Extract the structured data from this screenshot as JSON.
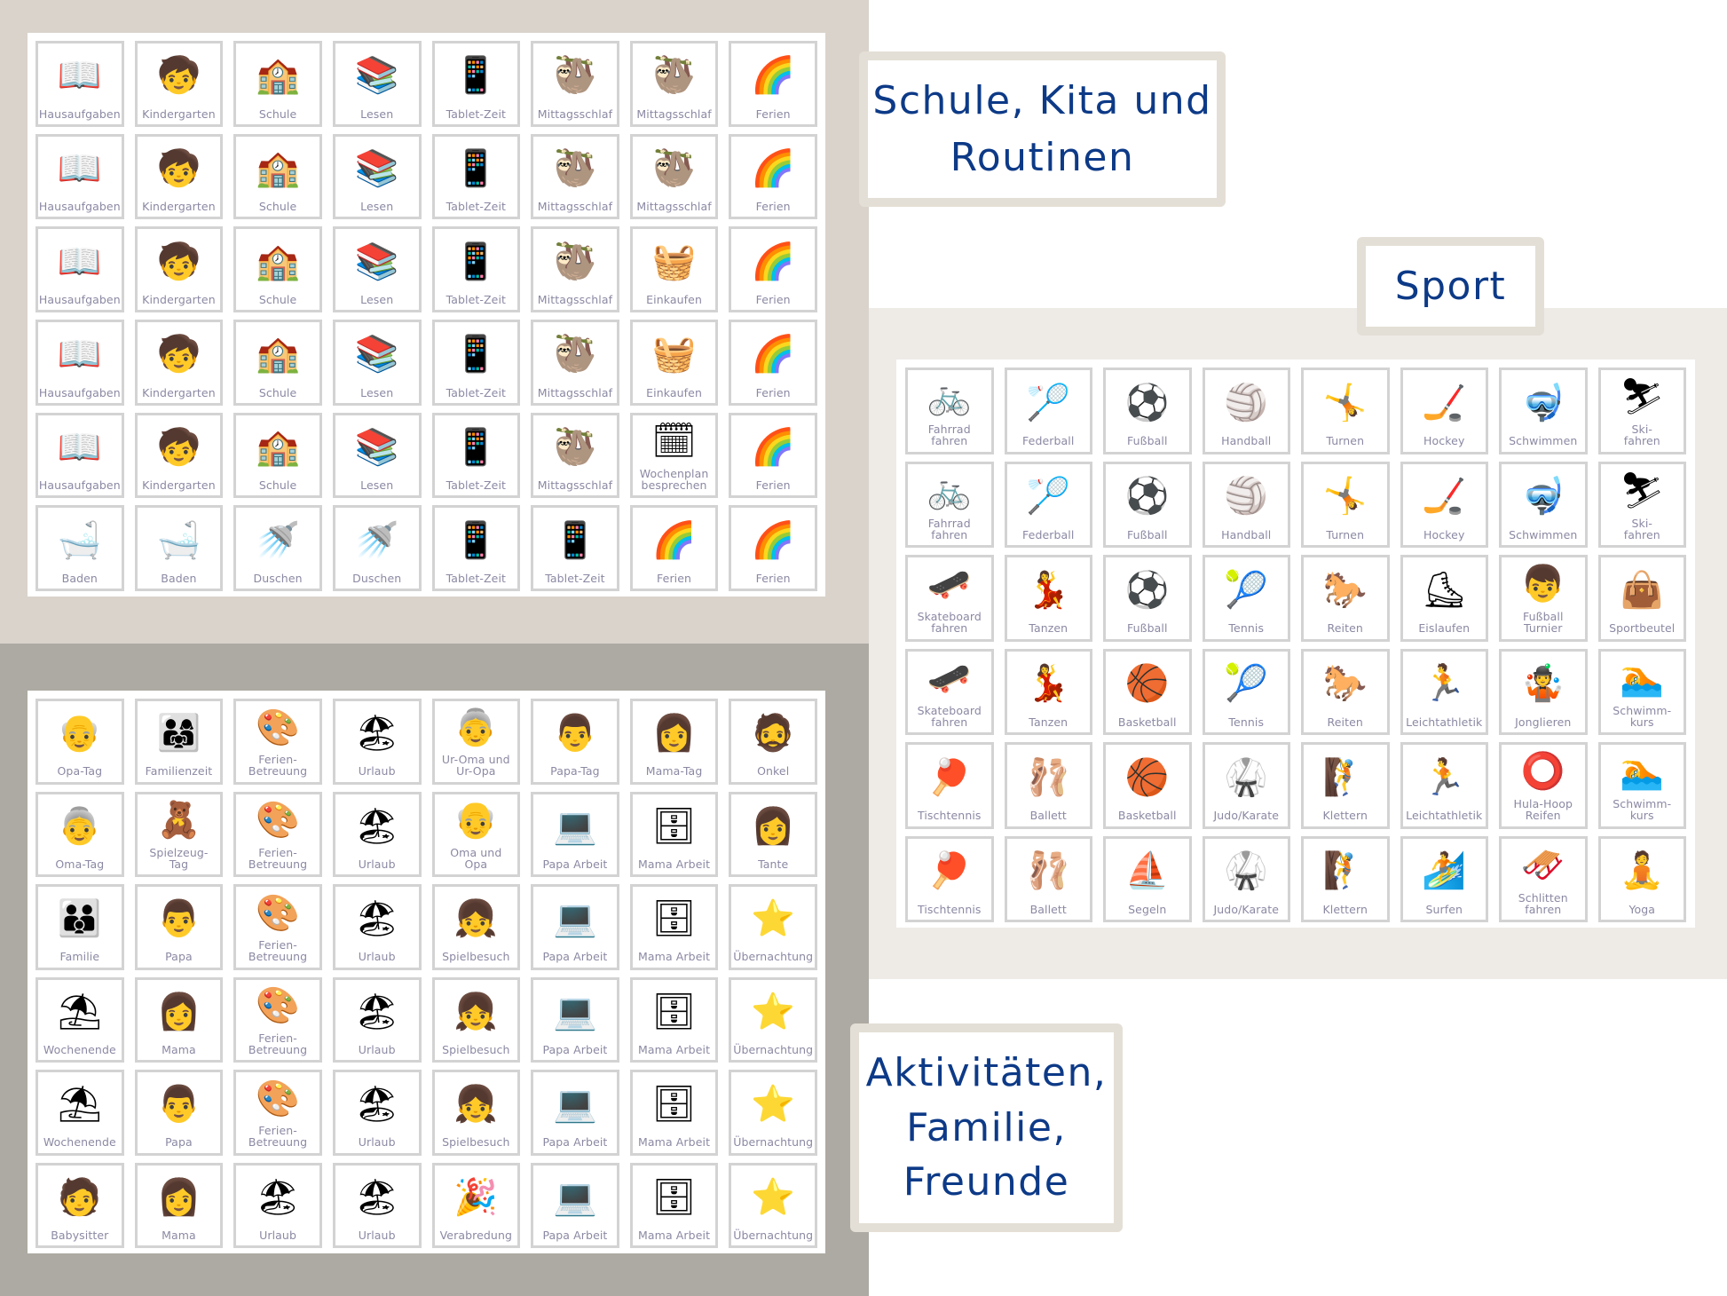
{
  "colors": {
    "title_text": "#0d3a87",
    "label_text": "#8b89a3",
    "tile_border": "#d3d3d3",
    "label_box_border": "#e4dfd6",
    "bg_school": "#d9d3cc",
    "bg_family": "#adaaa3",
    "bg_sport": "#eeebe7"
  },
  "section_titles": {
    "school": "Schule, Kita und\nRoutinen",
    "sport": "Sport",
    "family": "Aktivitäten,\nFamilie,\nFreunde"
  },
  "icon_map": {
    "homework": "📖",
    "kindergarten": "🧒",
    "school": "🏫",
    "reading": "📚",
    "tablet": "📱",
    "sloth": "🦥",
    "holiday": "🌈",
    "shopping": "🧺",
    "weekplan": "🗓",
    "bath": "🛁",
    "shower": "🚿",
    "bicycle": "🚲",
    "badminton": "🏸",
    "soccer": "⚽",
    "handball": "🏐",
    "rings": "🤸",
    "hockey": "🏒",
    "snorkel": "🤿",
    "ski": "⛷",
    "skateboard": "🛹",
    "dance": "💃",
    "tennis": "🎾",
    "saddle": "🐎",
    "skates": "⛸",
    "soccer-kids": "👦",
    "gym-bag": "👜",
    "basketball": "🏀",
    "athletics": "🏃",
    "juggling": "🤹",
    "pool": "🏊",
    "table-tennis": "🏓",
    "ballet": "🩰",
    "judo": "🥋",
    "climbing": "🧗",
    "hula-hoop": "⭕",
    "sailing": "⛵",
    "surfing": "🏄",
    "sled": "🛷",
    "yoga": "🧘",
    "grandpa": "👴",
    "family-picnic": "👨‍👩‍👧",
    "holiday-care": "🎨",
    "beach": "🏖",
    "great-grandparents": "👵",
    "papa-day": "👨",
    "mama-day": "👩",
    "uncle": "🧔",
    "grandma": "👵",
    "toys": "🧸",
    "grandparents": "👴",
    "work-papa": "💻",
    "work-mama": "🗄",
    "aunt": "👩",
    "family": "👪",
    "papa": "👨",
    "playdate": "👧",
    "sleepover": "⭐",
    "hammock": "⛱",
    "mama": "👩",
    "babysitter": "🧑",
    "appointment": "🎉"
  },
  "school_cards": [
    {
      "label": "Hausaufgaben",
      "icon": "homework"
    },
    {
      "label": "Kindergarten",
      "icon": "kindergarten"
    },
    {
      "label": "Schule",
      "icon": "school"
    },
    {
      "label": "Lesen",
      "icon": "reading"
    },
    {
      "label": "Tablet-Zeit",
      "icon": "tablet"
    },
    {
      "label": "Mittagsschlaf",
      "icon": "sloth"
    },
    {
      "label": "Mittagsschlaf",
      "icon": "sloth"
    },
    {
      "label": "Ferien",
      "icon": "holiday"
    },
    {
      "label": "Hausaufgaben",
      "icon": "homework"
    },
    {
      "label": "Kindergarten",
      "icon": "kindergarten"
    },
    {
      "label": "Schule",
      "icon": "school"
    },
    {
      "label": "Lesen",
      "icon": "reading"
    },
    {
      "label": "Tablet-Zeit",
      "icon": "tablet"
    },
    {
      "label": "Mittagsschlaf",
      "icon": "sloth"
    },
    {
      "label": "Mittagsschlaf",
      "icon": "sloth"
    },
    {
      "label": "Ferien",
      "icon": "holiday"
    },
    {
      "label": "Hausaufgaben",
      "icon": "homework"
    },
    {
      "label": "Kindergarten",
      "icon": "kindergarten"
    },
    {
      "label": "Schule",
      "icon": "school"
    },
    {
      "label": "Lesen",
      "icon": "reading"
    },
    {
      "label": "Tablet-Zeit",
      "icon": "tablet"
    },
    {
      "label": "Mittagsschlaf",
      "icon": "sloth"
    },
    {
      "label": "Einkaufen",
      "icon": "shopping"
    },
    {
      "label": "Ferien",
      "icon": "holiday"
    },
    {
      "label": "Hausaufgaben",
      "icon": "homework"
    },
    {
      "label": "Kindergarten",
      "icon": "kindergarten"
    },
    {
      "label": "Schule",
      "icon": "school"
    },
    {
      "label": "Lesen",
      "icon": "reading"
    },
    {
      "label": "Tablet-Zeit",
      "icon": "tablet"
    },
    {
      "label": "Mittagsschlaf",
      "icon": "sloth"
    },
    {
      "label": "Einkaufen",
      "icon": "shopping"
    },
    {
      "label": "Ferien",
      "icon": "holiday"
    },
    {
      "label": "Hausaufgaben",
      "icon": "homework"
    },
    {
      "label": "Kindergarten",
      "icon": "kindergarten"
    },
    {
      "label": "Schule",
      "icon": "school"
    },
    {
      "label": "Lesen",
      "icon": "reading"
    },
    {
      "label": "Tablet-Zeit",
      "icon": "tablet"
    },
    {
      "label": "Mittagsschlaf",
      "icon": "sloth"
    },
    {
      "label": "Wochenplan\nbesprechen",
      "icon": "weekplan"
    },
    {
      "label": "Ferien",
      "icon": "holiday"
    },
    {
      "label": "Baden",
      "icon": "bath"
    },
    {
      "label": "Baden",
      "icon": "bath"
    },
    {
      "label": "Duschen",
      "icon": "shower"
    },
    {
      "label": "Duschen",
      "icon": "shower"
    },
    {
      "label": "Tablet-Zeit",
      "icon": "tablet"
    },
    {
      "label": "Tablet-Zeit",
      "icon": "tablet"
    },
    {
      "label": "Ferien",
      "icon": "holiday"
    },
    {
      "label": "Ferien",
      "icon": "holiday"
    }
  ],
  "sport_cards": [
    {
      "label": "Fahrrad\nfahren",
      "icon": "bicycle"
    },
    {
      "label": "Federball",
      "icon": "badminton"
    },
    {
      "label": "Fußball",
      "icon": "soccer"
    },
    {
      "label": "Handball",
      "icon": "handball"
    },
    {
      "label": "Turnen",
      "icon": "rings"
    },
    {
      "label": "Hockey",
      "icon": "hockey"
    },
    {
      "label": "Schwimmen",
      "icon": "snorkel"
    },
    {
      "label": "Ski-\nfahren",
      "icon": "ski"
    },
    {
      "label": "Fahrrad\nfahren",
      "icon": "bicycle"
    },
    {
      "label": "Federball",
      "icon": "badminton"
    },
    {
      "label": "Fußball",
      "icon": "soccer"
    },
    {
      "label": "Handball",
      "icon": "handball"
    },
    {
      "label": "Turnen",
      "icon": "rings"
    },
    {
      "label": "Hockey",
      "icon": "hockey"
    },
    {
      "label": "Schwimmen",
      "icon": "snorkel"
    },
    {
      "label": "Ski-\nfahren",
      "icon": "ski"
    },
    {
      "label": "Skateboard\nfahren",
      "icon": "skateboard"
    },
    {
      "label": "Tanzen",
      "icon": "dance"
    },
    {
      "label": "Fußball",
      "icon": "soccer"
    },
    {
      "label": "Tennis",
      "icon": "tennis"
    },
    {
      "label": "Reiten",
      "icon": "saddle"
    },
    {
      "label": "Eislaufen",
      "icon": "skates"
    },
    {
      "label": "Fußball\nTurnier",
      "icon": "soccer-kids"
    },
    {
      "label": "Sportbeutel",
      "icon": "gym-bag"
    },
    {
      "label": "Skateboard\nfahren",
      "icon": "skateboard"
    },
    {
      "label": "Tanzen",
      "icon": "dance"
    },
    {
      "label": "Basketball",
      "icon": "basketball"
    },
    {
      "label": "Tennis",
      "icon": "tennis"
    },
    {
      "label": "Reiten",
      "icon": "saddle"
    },
    {
      "label": "Leichtathletik",
      "icon": "athletics"
    },
    {
      "label": "Jonglieren",
      "icon": "juggling"
    },
    {
      "label": "Schwimm-\nkurs",
      "icon": "pool"
    },
    {
      "label": "Tischtennis",
      "icon": "table-tennis"
    },
    {
      "label": "Ballett",
      "icon": "ballet"
    },
    {
      "label": "Basketball",
      "icon": "basketball"
    },
    {
      "label": "Judo/Karate",
      "icon": "judo"
    },
    {
      "label": "Klettern",
      "icon": "climbing"
    },
    {
      "label": "Leichtathletik",
      "icon": "athletics"
    },
    {
      "label": "Hula-Hoop\nReifen",
      "icon": "hula-hoop"
    },
    {
      "label": "Schwimm-\nkurs",
      "icon": "pool"
    },
    {
      "label": "Tischtennis",
      "icon": "table-tennis"
    },
    {
      "label": "Ballett",
      "icon": "ballet"
    },
    {
      "label": "Segeln",
      "icon": "sailing"
    },
    {
      "label": "Judo/Karate",
      "icon": "judo"
    },
    {
      "label": "Klettern",
      "icon": "climbing"
    },
    {
      "label": "Surfen",
      "icon": "surfing"
    },
    {
      "label": "Schlitten\nfahren",
      "icon": "sled"
    },
    {
      "label": "Yoga",
      "icon": "yoga"
    }
  ],
  "family_cards": [
    {
      "label": "Opa-Tag",
      "icon": "grandpa"
    },
    {
      "label": "Familienzeit",
      "icon": "family-picnic"
    },
    {
      "label": "Ferien-\nBetreuung",
      "icon": "holiday-care"
    },
    {
      "label": "Urlaub",
      "icon": "beach"
    },
    {
      "label": "Ur-Oma und\nUr-Opa",
      "icon": "great-grandparents"
    },
    {
      "label": "Papa-Tag",
      "icon": "papa-day"
    },
    {
      "label": "Mama-Tag",
      "icon": "mama-day"
    },
    {
      "label": "Onkel",
      "icon": "uncle"
    },
    {
      "label": "Oma-Tag",
      "icon": "grandma"
    },
    {
      "label": "Spielzeug-\nTag",
      "icon": "toys"
    },
    {
      "label": "Ferien-\nBetreuung",
      "icon": "holiday-care"
    },
    {
      "label": "Urlaub",
      "icon": "beach"
    },
    {
      "label": "Oma und\nOpa",
      "icon": "grandparents"
    },
    {
      "label": "Papa Arbeit",
      "icon": "work-papa"
    },
    {
      "label": "Mama Arbeit",
      "icon": "work-mama"
    },
    {
      "label": "Tante",
      "icon": "aunt"
    },
    {
      "label": "Familie",
      "icon": "family"
    },
    {
      "label": "Papa",
      "icon": "papa"
    },
    {
      "label": "Ferien-\nBetreuung",
      "icon": "holiday-care"
    },
    {
      "label": "Urlaub",
      "icon": "beach"
    },
    {
      "label": "Spielbesuch",
      "icon": "playdate"
    },
    {
      "label": "Papa Arbeit",
      "icon": "work-papa"
    },
    {
      "label": "Mama Arbeit",
      "icon": "work-mama"
    },
    {
      "label": "Übernachtung",
      "icon": "sleepover"
    },
    {
      "label": "Wochenende",
      "icon": "hammock"
    },
    {
      "label": "Mama",
      "icon": "mama"
    },
    {
      "label": "Ferien-\nBetreuung",
      "icon": "holiday-care"
    },
    {
      "label": "Urlaub",
      "icon": "beach"
    },
    {
      "label": "Spielbesuch",
      "icon": "playdate"
    },
    {
      "label": "Papa Arbeit",
      "icon": "work-papa"
    },
    {
      "label": "Mama Arbeit",
      "icon": "work-mama"
    },
    {
      "label": "Übernachtung",
      "icon": "sleepover"
    },
    {
      "label": "Wochenende",
      "icon": "hammock"
    },
    {
      "label": "Papa",
      "icon": "papa"
    },
    {
      "label": "Ferien-\nBetreuung",
      "icon": "holiday-care"
    },
    {
      "label": "Urlaub",
      "icon": "beach"
    },
    {
      "label": "Spielbesuch",
      "icon": "playdate"
    },
    {
      "label": "Papa Arbeit",
      "icon": "work-papa"
    },
    {
      "label": "Mama Arbeit",
      "icon": "work-mama"
    },
    {
      "label": "Übernachtung",
      "icon": "sleepover"
    },
    {
      "label": "Babysitter",
      "icon": "babysitter"
    },
    {
      "label": "Mama",
      "icon": "mama"
    },
    {
      "label": "Urlaub",
      "icon": "beach"
    },
    {
      "label": "Urlaub",
      "icon": "beach"
    },
    {
      "label": "Verabredung",
      "icon": "appointment"
    },
    {
      "label": "Papa Arbeit",
      "icon": "work-papa"
    },
    {
      "label": "Mama Arbeit",
      "icon": "work-mama"
    },
    {
      "label": "Übernachtung",
      "icon": "sleepover"
    }
  ]
}
